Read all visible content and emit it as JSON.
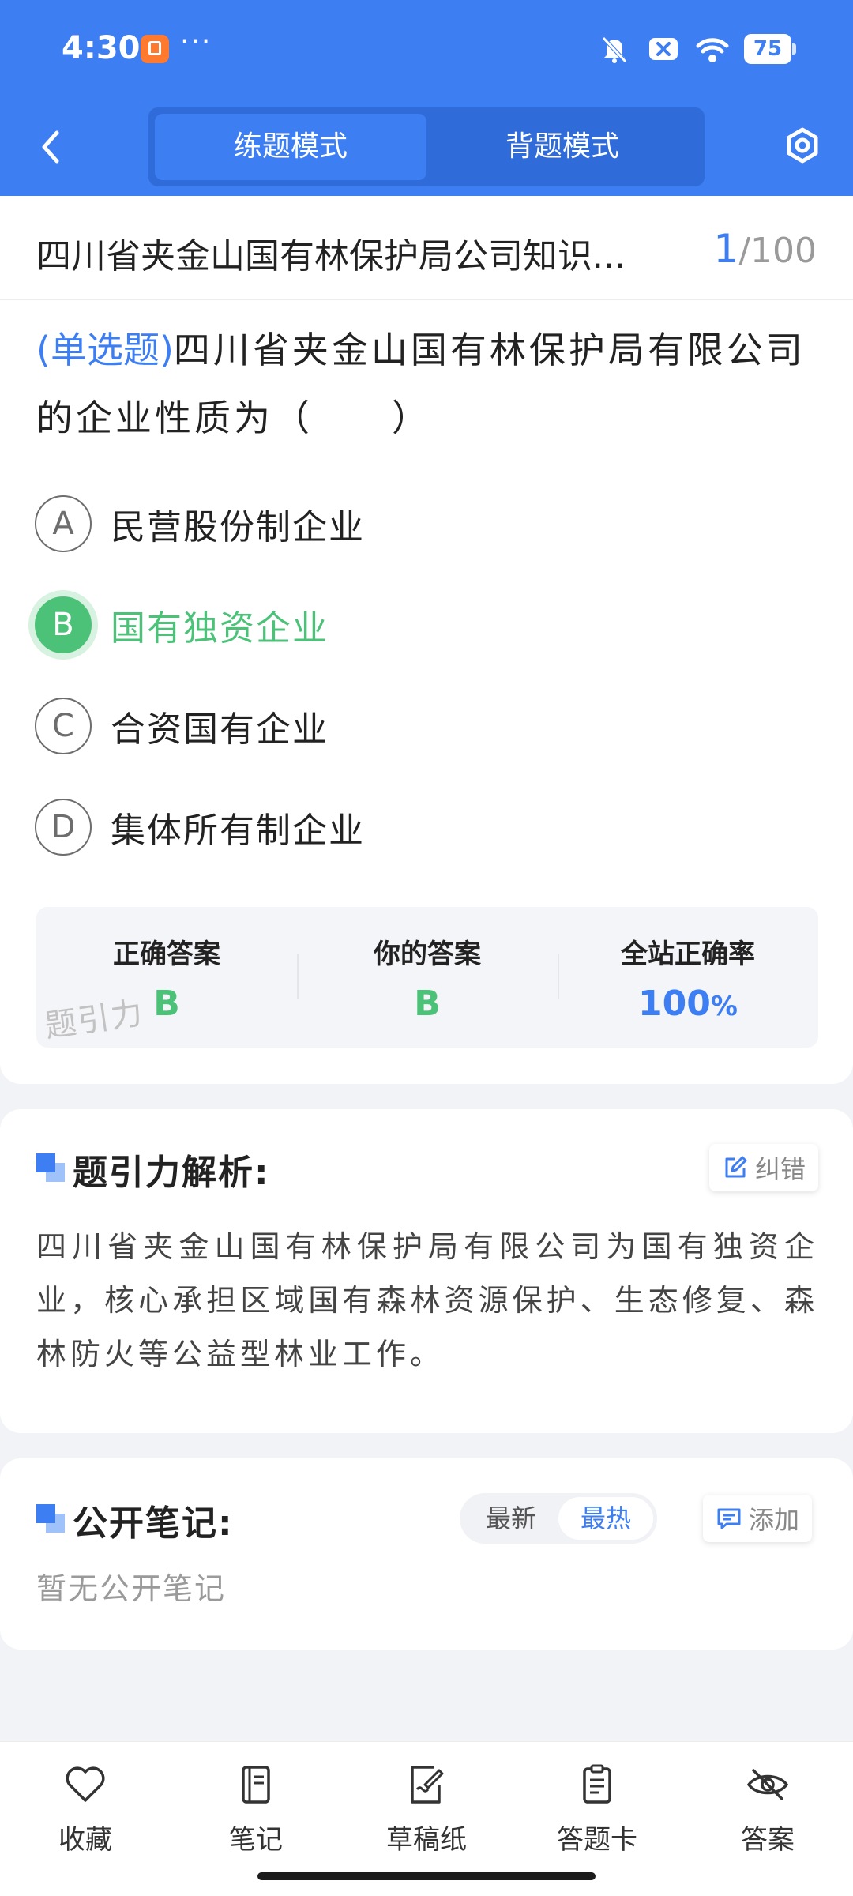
{
  "status_bar": {
    "time": "4:30",
    "more": "···",
    "battery": "75"
  },
  "nav": {
    "modes": [
      "练题模式",
      "背题模式"
    ],
    "active_mode": "练题模式"
  },
  "exam": {
    "title": "四川省夹金山国有林保护局公司知识...",
    "current": "1",
    "total": "/100"
  },
  "question": {
    "type": "(单选题)",
    "text": "四川省夹金山国有林保护局有限公司的企业性质为（　　）",
    "options": [
      {
        "letter": "A",
        "text": "民营股份制企业"
      },
      {
        "letter": "B",
        "text": "国有独资企业"
      },
      {
        "letter": "C",
        "text": "合资国有企业"
      },
      {
        "letter": "D",
        "text": "集体所有制企业"
      }
    ],
    "selected": "B"
  },
  "stats": {
    "correct_label": "正确答案",
    "correct_value": "B",
    "yours_label": "你的答案",
    "yours_value": "B",
    "rate_label": "全站正确率",
    "rate_value": "100",
    "rate_unit": "%",
    "watermark": "题引力"
  },
  "analysis": {
    "title": "题引力解析:",
    "report_label": "纠错",
    "text": "四川省夹金山国有林保护局有限公司为国有独资企业，核心承担区域国有森林资源保护、生态修复、森林防火等公益型林业工作。"
  },
  "notes": {
    "title": "公开笔记:",
    "sort_options": [
      "最新",
      "最热"
    ],
    "active_sort": "最热",
    "add_label": "添加",
    "empty_text": "暂无公开笔记"
  },
  "toolbar": {
    "items": [
      {
        "label": "收藏",
        "icon": "heart-icon"
      },
      {
        "label": "笔记",
        "icon": "notebook-icon"
      },
      {
        "label": "草稿纸",
        "icon": "draft-paper-icon"
      },
      {
        "label": "答题卡",
        "icon": "answer-card-icon"
      },
      {
        "label": "答案",
        "icon": "eye-off-icon"
      }
    ]
  },
  "colors": {
    "brand_blue": "#3d7ef2",
    "correct_green": "#4cc279"
  }
}
